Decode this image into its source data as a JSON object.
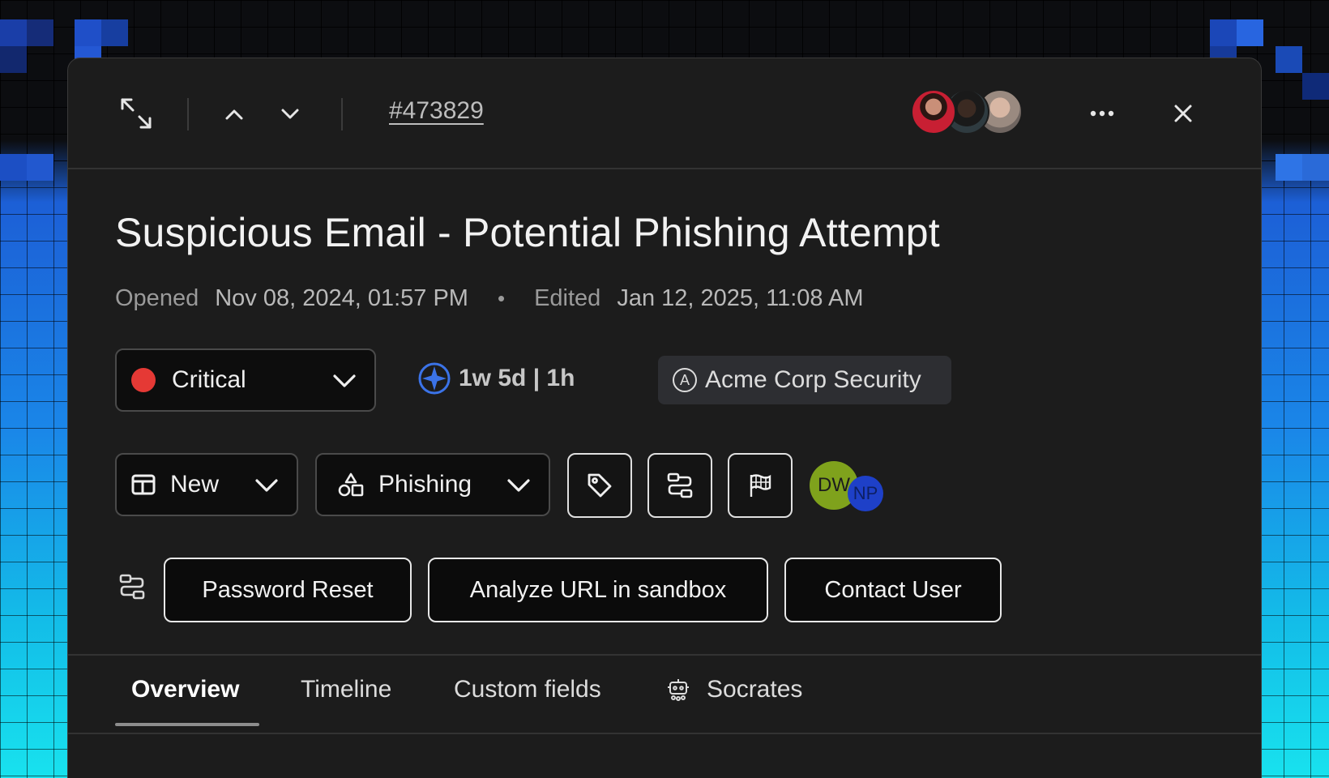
{
  "ticket": {
    "id": "#473829",
    "title": "Suspicious Email - Potential Phishing Attempt",
    "opened_label": "Opened",
    "opened_value": "Nov 08, 2024, 01:57 PM",
    "separator": "•",
    "edited_label": "Edited",
    "edited_value": "Jan 12, 2025, 11:08 AM"
  },
  "severity": {
    "label": "Critical",
    "color": "#e53935"
  },
  "sla": {
    "text": "1w 5d | 1h",
    "icon": "compass-star-icon",
    "color": "#3b73e8"
  },
  "team": {
    "icon_letter": "A",
    "label": "Acme Corp Security"
  },
  "status": {
    "label": "New",
    "icon": "board-icon"
  },
  "category": {
    "label": "Phishing",
    "icon": "shapes-icon"
  },
  "toolbar_icons": [
    "tag-icon",
    "workflow-icon",
    "flag-icon"
  ],
  "assignees": [
    {
      "initials": "DW",
      "color": "#7fa21c",
      "text_color": "#1c1c1c"
    },
    {
      "initials": "NP",
      "color": "#1e40c8",
      "text_color": "#0d1f63"
    }
  ],
  "actions": {
    "icon": "workflow-icon",
    "items": [
      "Password Reset",
      "Analyze URL in sandbox",
      "Contact User"
    ]
  },
  "tabs": [
    {
      "label": "Overview",
      "active": true
    },
    {
      "label": "Timeline",
      "active": false
    },
    {
      "label": "Custom fields",
      "active": false
    },
    {
      "label": "Socrates",
      "active": false,
      "icon": "robot-icon"
    }
  ]
}
